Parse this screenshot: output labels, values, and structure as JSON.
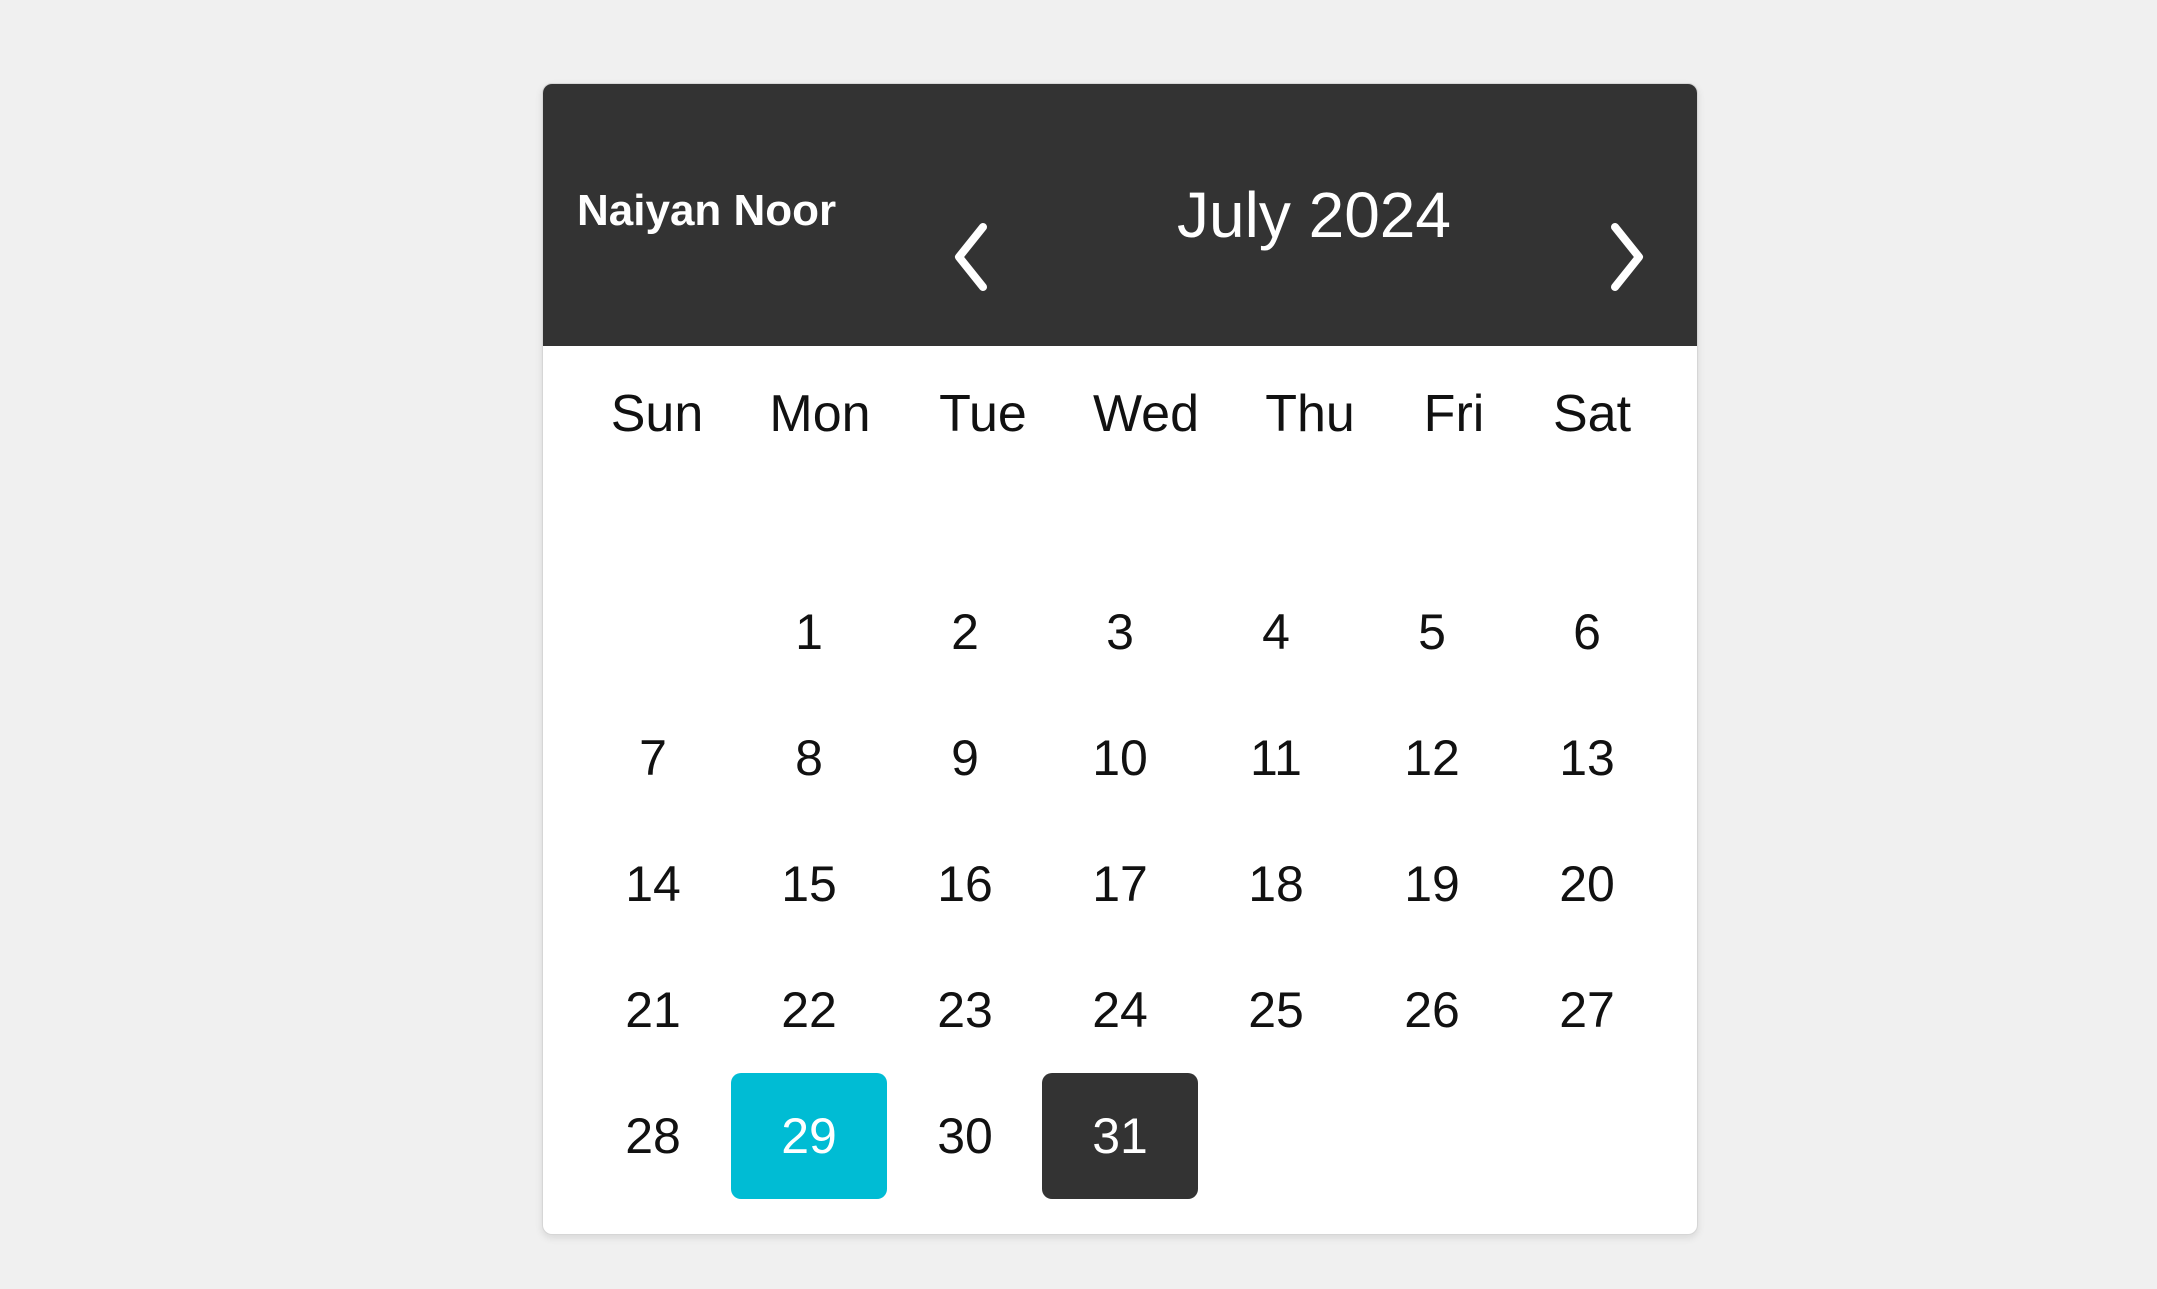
{
  "header": {
    "owner_name": "Naiyan Noor",
    "month_title": "July 2024",
    "prev_icon": "chevron-left-icon",
    "next_icon": "chevron-right-icon"
  },
  "weekdays": [
    "Sun",
    "Mon",
    "Tue",
    "Wed",
    "Thu",
    "Fri",
    "Sat"
  ],
  "month": {
    "first_weekday_index": 1,
    "days": [
      "1",
      "2",
      "3",
      "4",
      "5",
      "6",
      "7",
      "8",
      "9",
      "10",
      "11",
      "12",
      "13",
      "14",
      "15",
      "16",
      "17",
      "18",
      "19",
      "20",
      "21",
      "22",
      "23",
      "24",
      "25",
      "26",
      "27",
      "28",
      "29",
      "30",
      "31"
    ],
    "today": "29",
    "selected": "31"
  },
  "colors": {
    "header_background": "#333333",
    "today_background": "#00bcd4",
    "selected_background": "#333333",
    "page_background": "#f0f0f0"
  }
}
